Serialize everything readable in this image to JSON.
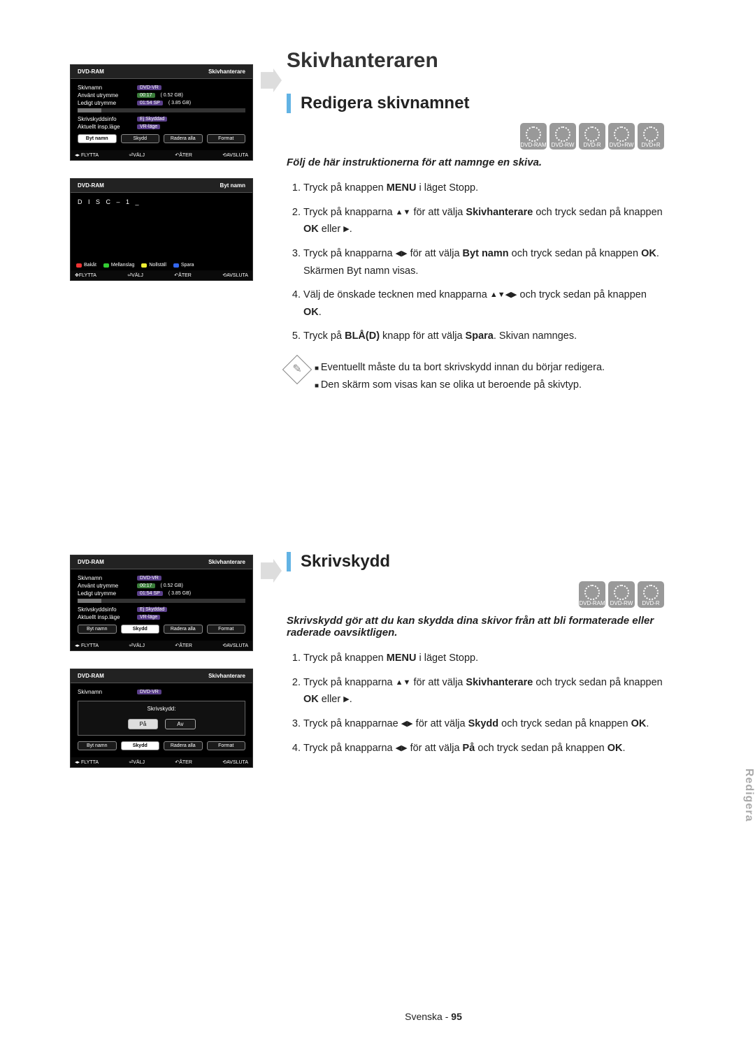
{
  "page": {
    "main_title": "Skivhanteraren",
    "footer_lang": "Svenska",
    "footer_page": "95",
    "side_tab": "Redigera"
  },
  "sections": {
    "rename": {
      "title": "Redigera skivnamnet",
      "discs": [
        "DVD-RAM",
        "DVD-RW",
        "DVD-R",
        "DVD+RW",
        "DVD+R"
      ],
      "intro": "Följ de här instruktionerna för att namnge en skiva.",
      "steps": [
        "Tryck på knappen MENU i läget Stopp.",
        "Tryck på knapparna ▲▼ för att välja Skivhanterare och tryck sedan på knappen OK eller ▶.",
        "Tryck på knapparna ◀▶ för att välja Byt namn och tryck sedan på knappen OK.\nSkärmen Byt namn visas.",
        "Välj de önskade tecknen med knapparna ▲▼◀▶ och tryck sedan på knappen OK.",
        "Tryck på BLÅ(D) knapp för att välja Spara. Skivan namnges."
      ],
      "notes": [
        "Eventuellt måste du ta bort skrivskydd innan du börjar redigera.",
        "Den skärm som visas kan se olika ut beroende på skivtyp."
      ]
    },
    "protect": {
      "title": "Skrivskydd",
      "discs": [
        "DVD-RAM",
        "DVD-RW",
        "DVD-R"
      ],
      "intro": "Skrivskydd gör att du kan skydda dina skivor från att bli formaterade eller raderade oavsiktligen.",
      "steps": [
        "Tryck på knappen MENU i läget Stopp.",
        "Tryck på knapparna ▲▼ för att välja Skivhanterare och tryck sedan på knappen OK eller ▶.",
        "Tryck på knapparnae ◀▶ för att välja Skydd och tryck sedan på knappen OK.",
        "Tryck på knapparna ◀▶ för att välja På och tryck sedan på knappen OK."
      ]
    }
  },
  "osd": {
    "hdr_left": "DVD-RAM",
    "hdr_mgr": "Skivhanterare",
    "hdr_rename": "Byt namn",
    "fields": {
      "name_lbl": "Skivnamn",
      "name_val": "DVD-VR",
      "used_lbl": "Använt utrymme",
      "used_time": "00:17",
      "used_size": "( 0.52 GB)",
      "free_lbl": "Ledigt utrymme",
      "free_time": "01:54 SP",
      "free_size": "( 3.85 GB)",
      "prot_lbl": "Skrivskyddsinfo",
      "prot_val": "Ej Skyddad",
      "rec_lbl": "Aktuellt insp.läge",
      "rec_val": "VR-läge"
    },
    "buttons": {
      "rename": "Byt namn",
      "protect": "Skydd",
      "erase": "Radera alla",
      "format": "Format"
    },
    "navbar": {
      "move": "FLYTTA",
      "select": "VÄLJ",
      "return": "ÅTER",
      "exit": "AVSLUTA"
    },
    "disc_input": "D I S C – 1 _",
    "color": {
      "back": "Bakåt",
      "space": "Mellanslag",
      "clear": "Nollställ",
      "save": "Spara"
    },
    "popup": {
      "title": "Skrivskydd:",
      "on": "På",
      "off": "Av"
    }
  }
}
